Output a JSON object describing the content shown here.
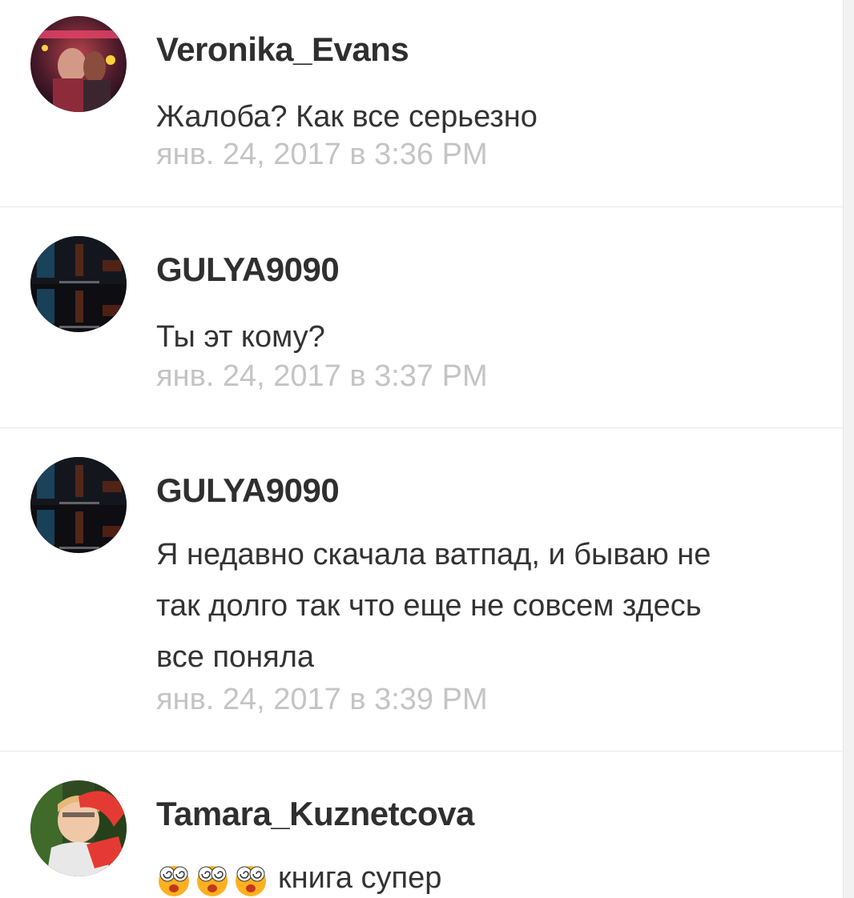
{
  "colors": {
    "username": "#2f2f2f",
    "text": "#333333",
    "timestamp": "#c4c4c4",
    "divider": "#e8e8e8",
    "background": "#ffffff"
  },
  "comments": [
    {
      "username": "Veronika_Evans",
      "text": "Жалоба? Как все серьезно",
      "timestamp": "янв. 24, 2017 в 3:36 PM",
      "avatar_icon": "user-photo-avatar"
    },
    {
      "username": "GULYA9090",
      "text": "Ты эт кому?",
      "timestamp": "янв. 24, 2017 в 3:37 PM",
      "avatar_icon": "user-photo-avatar"
    },
    {
      "username": "GULYA9090",
      "text_lines": [
        "Я недавно скачала ватпад, и бываю не",
        "так долго так что еще не совсем здесь",
        "все поняла"
      ],
      "timestamp": "янв. 24, 2017 в 3:39 PM",
      "avatar_icon": "user-photo-avatar"
    },
    {
      "username": "Tamara_Kuznetcova",
      "emojis": [
        "dizzy-face-emoji",
        "dizzy-face-emoji",
        "dizzy-face-emoji"
      ],
      "text": "книга супер",
      "avatar_icon": "user-photo-avatar"
    }
  ]
}
